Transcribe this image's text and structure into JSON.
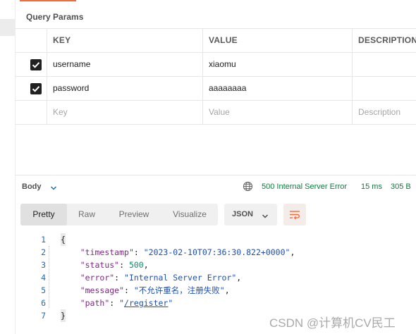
{
  "query_params": {
    "title": "Query Params",
    "columns": {
      "key": "KEY",
      "value": "VALUE",
      "description": "DESCRIPTION"
    },
    "rows": [
      {
        "checked": true,
        "key": "username",
        "value": "xiaomu",
        "description": ""
      },
      {
        "checked": true,
        "key": "password",
        "value": "aaaaaaaa",
        "description": ""
      }
    ],
    "new_row": {
      "key_placeholder": "Key",
      "value_placeholder": "Value",
      "description_placeholder": "Description"
    }
  },
  "response": {
    "section_label": "Body",
    "status": "500 Internal Server Error",
    "time": "15 ms",
    "size": "305 B",
    "tabs": [
      "Pretty",
      "Raw",
      "Preview",
      "Visualize"
    ],
    "active_tab": "Pretty",
    "format": "JSON",
    "code": {
      "line_numbers": [
        "1",
        "2",
        "3",
        "4",
        "5",
        "6",
        "7"
      ],
      "open_brace": "{",
      "close_brace": "}",
      "timestamp_key": "\"timestamp\"",
      "timestamp_value": "\"2023-02-10T07:36:30.822+0000\"",
      "status_key": "\"status\"",
      "status_value": "500",
      "error_key": "\"error\"",
      "error_value": "\"Internal Server Error\"",
      "message_key": "\"message\"",
      "message_value": "\"不允许重名，注册失败\"",
      "path_key": "\"path\"",
      "path_value": "/register"
    }
  },
  "watermark": "CSDN @计算机CV民工",
  "colors": {
    "accent": "#f26b3a",
    "status_error": "#0b7a3e",
    "json_key": "#7b2b80",
    "json_string": "#1f4fb5",
    "json_number": "#0f8a6a"
  }
}
